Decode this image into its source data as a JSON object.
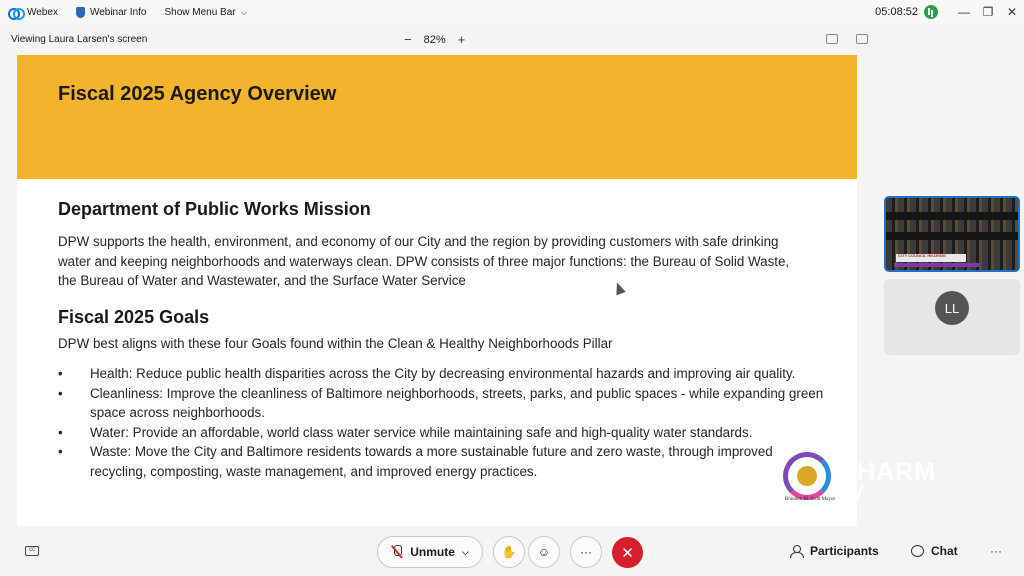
{
  "titlebar": {
    "app_name": "Webex",
    "webinar_info": "Webinar Info",
    "show_menu_bar": "Show Menu Bar",
    "clock": "05:08:52",
    "minimize": "—",
    "restore": "❐",
    "close": "✕"
  },
  "viewbar": {
    "viewing_label": "Viewing Laura Larsen's screen",
    "zoom_out": "−",
    "zoom_level": "82%",
    "zoom_in": "+"
  },
  "slide": {
    "title": "Fiscal 2025 Agency Overview",
    "mission_heading": "Department of Public Works Mission",
    "mission_text": "DPW supports the health, environment, and economy of our City and the region by providing customers with safe drinking water and keeping neighborhoods and waterways clean. DPW consists of three major functions: the Bureau of Solid Waste, the Bureau of Water and Wastewater, and the Surface Water Service",
    "goals_heading": "Fiscal 2025 Goals",
    "goals_intro": "DPW best aligns with these four Goals found within the Clean & Healthy Neighborhoods Pillar",
    "goals": [
      "Health: Reduce public health disparities across the City by decreasing environmental hazards and improving air quality.",
      "Cleanliness: Improve the cleanliness of Baltimore neighborhoods, streets, parks, and public spaces - while expanding green space across neighborhoods.",
      "Water: Provide an affordable, world class water service while maintaining safe and high-quality water standards.",
      "Waste: Move the City and Baltimore residents towards a more sustainable future and zero waste, through improved recycling, composting, waste management, and improved energy practices."
    ]
  },
  "watermark": {
    "brand": "CHARM",
    "tv": "TV",
    "caption": "Brandon M. Scott Mayor"
  },
  "panel": {
    "video_banner": "CITY COUNCIL HEARING",
    "avatar_initials": "LL"
  },
  "bottombar": {
    "unmute_label": "Unmute",
    "hand_icon": "✋",
    "reaction_icon": "☺",
    "more_icon": "···",
    "end_icon": "✕",
    "participants_label": "Participants",
    "chat_label": "Chat",
    "overflow_icon": "···"
  },
  "colors": {
    "header_band": "#f3b32c",
    "end_call": "#d4202c",
    "active_tile_border": "#1c72c6"
  }
}
